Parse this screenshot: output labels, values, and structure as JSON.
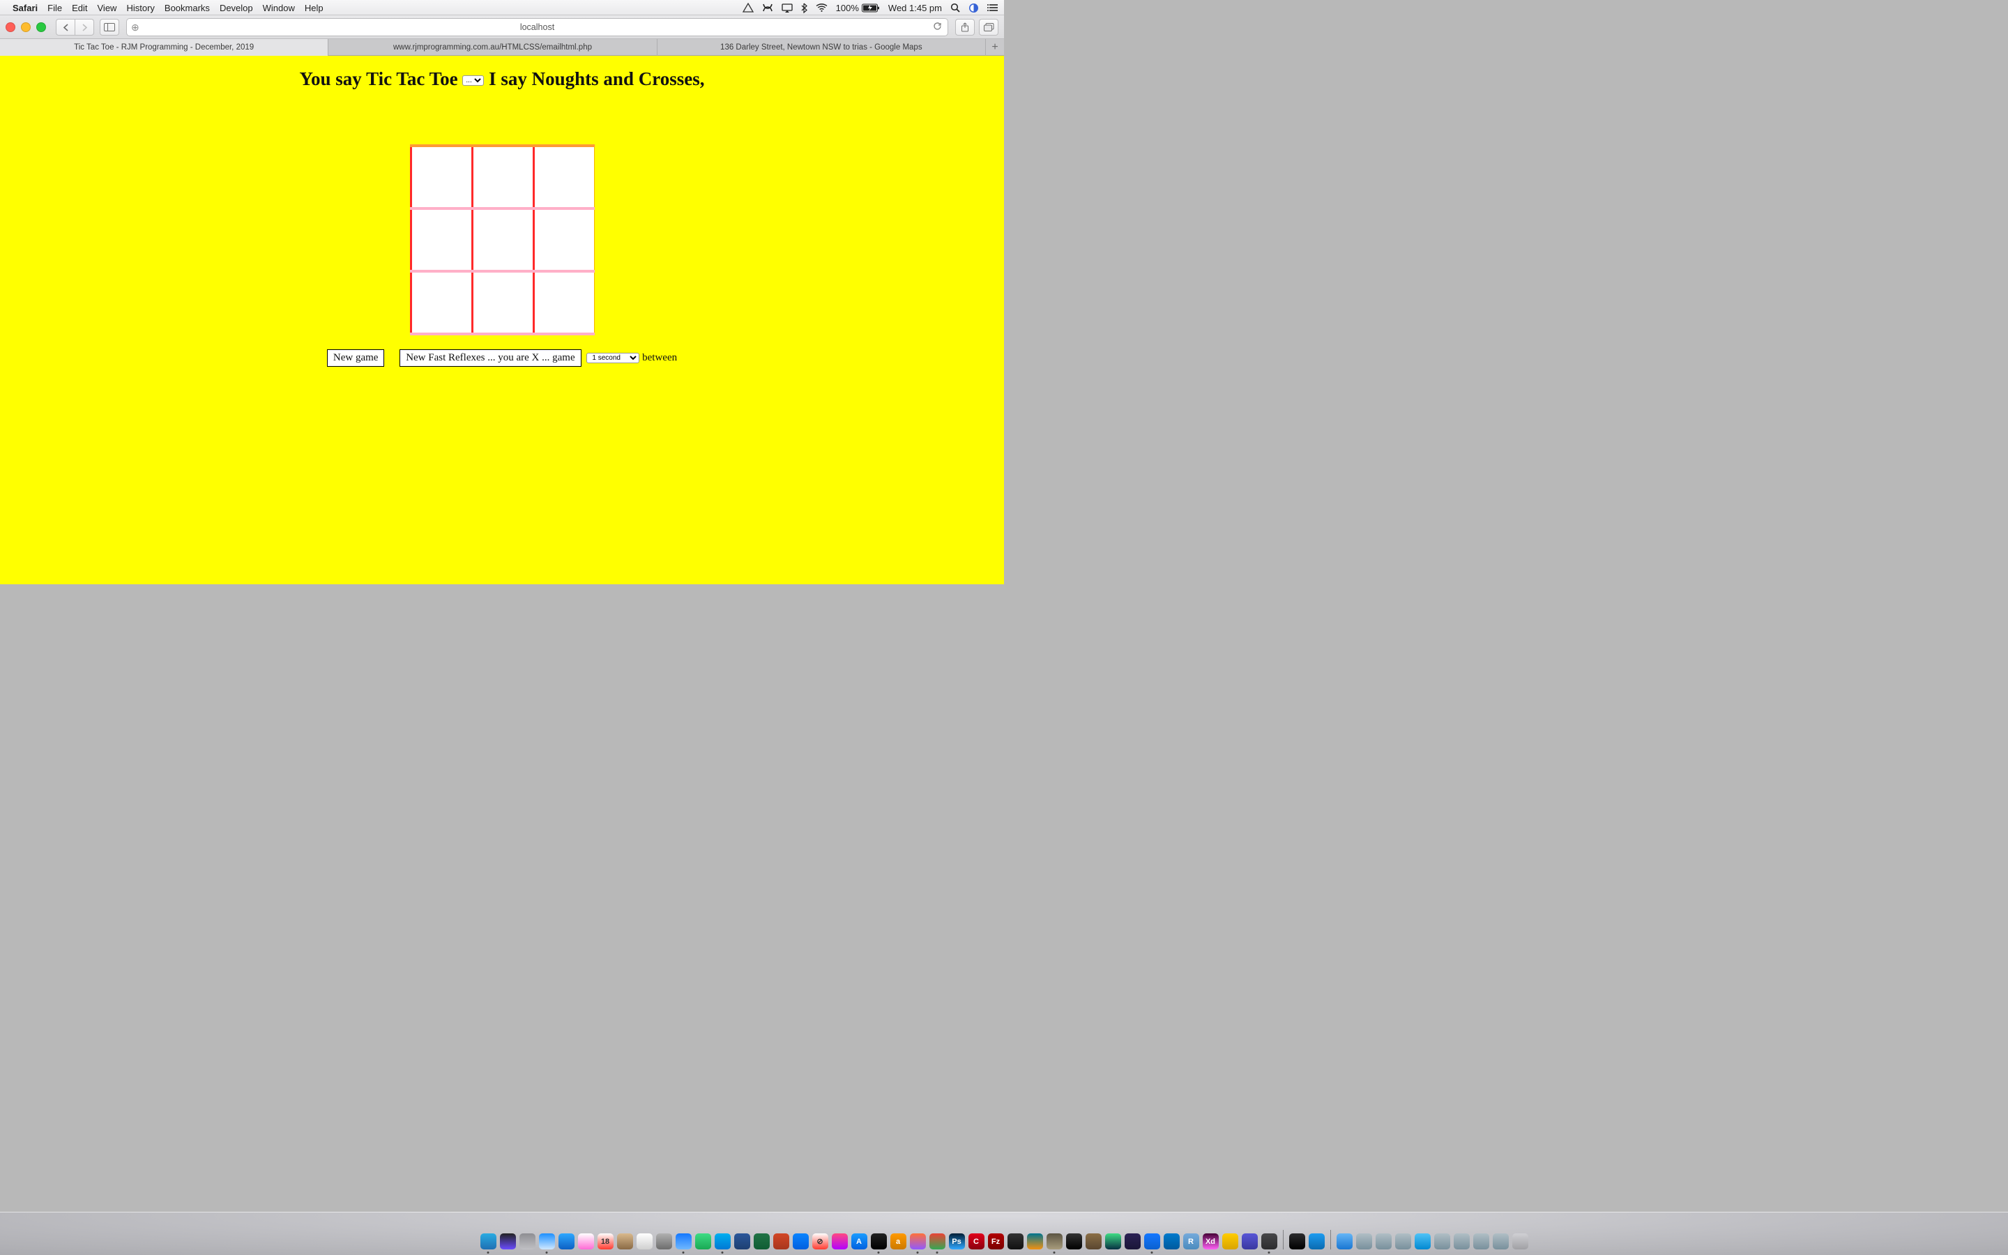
{
  "menubar": {
    "app": "Safari",
    "items": [
      "File",
      "Edit",
      "View",
      "History",
      "Bookmarks",
      "Develop",
      "Window",
      "Help"
    ],
    "battery": "100%",
    "clock": "Wed 1:45 pm"
  },
  "toolbar": {
    "url": "localhost"
  },
  "tabs": {
    "items": [
      {
        "label": "Tic Tac Toe - RJM Programming - December, 2019",
        "active": true
      },
      {
        "label": "www.rjmprogramming.com.au/HTMLCSS/emailhtml.php",
        "active": false
      },
      {
        "label": "136 Darley Street, Newtown NSW to trias - Google Maps",
        "active": false
      }
    ]
  },
  "page": {
    "heading_left": "You say Tic Tac Toe",
    "heading_select": "...",
    "heading_right": "I say Noughts and Crosses,",
    "board": [
      [
        "",
        "",
        ""
      ],
      [
        "",
        "",
        ""
      ],
      [
        "",
        "",
        ""
      ]
    ],
    "button_newgame": "New game",
    "button_fast": "New Fast Reflexes ... you are X ... game",
    "interval_select": "1 second",
    "interval_suffix": "between"
  },
  "dock": {
    "items": [
      {
        "name": "finder",
        "c1": "#29abe2",
        "c2": "#1f6fb3",
        "run": true
      },
      {
        "name": "siri",
        "c1": "#222",
        "c2": "#6a4cff"
      },
      {
        "name": "launchpad",
        "c1": "#8e8e93",
        "c2": "#c0c0c4"
      },
      {
        "name": "safari",
        "c1": "#1e90ff",
        "c2": "#cfe8ff",
        "run": true
      },
      {
        "name": "mail",
        "c1": "#2da7ff",
        "c2": "#0d60c3"
      },
      {
        "name": "photos",
        "c1": "#ffffff",
        "c2": "#ff6ad5"
      },
      {
        "name": "calendar",
        "c1": "#ffffff",
        "c2": "#ff3b30",
        "txt": "18"
      },
      {
        "name": "contacts",
        "c1": "#d9b98c",
        "c2": "#8a6a45"
      },
      {
        "name": "reminders",
        "c1": "#ffffff",
        "c2": "#d0d0d0"
      },
      {
        "name": "automator",
        "c1": "#b0b0b0",
        "c2": "#6d6d6d"
      },
      {
        "name": "preview",
        "c1": "#1478ff",
        "c2": "#70b8ff",
        "run": true
      },
      {
        "name": "messages",
        "c1": "#3ddc84",
        "c2": "#1aa954"
      },
      {
        "name": "skype",
        "c1": "#00aff0",
        "c2": "#0078d4",
        "run": true
      },
      {
        "name": "word",
        "c1": "#2b579a",
        "c2": "#1e3f72"
      },
      {
        "name": "excel",
        "c1": "#217346",
        "c2": "#0f5d34"
      },
      {
        "name": "powerpoint",
        "c1": "#d24726",
        "c2": "#a8361d"
      },
      {
        "name": "keynote",
        "c1": "#0a84ff",
        "c2": "#0060df"
      },
      {
        "name": "prohibit",
        "c1": "#ffffff",
        "c2": "#ff3b30",
        "txt": "⊘"
      },
      {
        "name": "itunes",
        "c1": "#ff4981",
        "c2": "#b200ff"
      },
      {
        "name": "appstore",
        "c1": "#1b9cff",
        "c2": "#0060df",
        "txt": "A"
      },
      {
        "name": "terminal",
        "c1": "#222",
        "c2": "#000",
        "run": true
      },
      {
        "name": "amazon",
        "c1": "#ff9900",
        "c2": "#cc7a00",
        "txt": "a"
      },
      {
        "name": "firefox",
        "c1": "#ff7139",
        "c2": "#9059ff",
        "run": true
      },
      {
        "name": "chrome",
        "c1": "#ea4335",
        "c2": "#34a853",
        "run": true
      },
      {
        "name": "photoshop",
        "c1": "#001e36",
        "c2": "#31a8ff",
        "txt": "Ps"
      },
      {
        "name": "ccleaner",
        "c1": "#e2001a",
        "c2": "#8a0010",
        "txt": "C"
      },
      {
        "name": "filezilla",
        "c1": "#b10000",
        "c2": "#7a0000",
        "txt": "Fz"
      },
      {
        "name": "mamp",
        "c1": "#333",
        "c2": "#111"
      },
      {
        "name": "mysql",
        "c1": "#00758f",
        "c2": "#f29111"
      },
      {
        "name": "gimp",
        "c1": "#5c5543",
        "c2": "#a89c7c",
        "run": true
      },
      {
        "name": "inkscape",
        "c1": "#333",
        "c2": "#000"
      },
      {
        "name": "app1",
        "c1": "#8b6f47",
        "c2": "#5a4630"
      },
      {
        "name": "android",
        "c1": "#3ddc84",
        "c2": "#073042"
      },
      {
        "name": "eclipse",
        "c1": "#2c2255",
        "c2": "#1a1538"
      },
      {
        "name": "xcode",
        "c1": "#1478ff",
        "c2": "#0a60d0",
        "run": true
      },
      {
        "name": "vscode",
        "c1": "#007acc",
        "c2": "#005a9e"
      },
      {
        "name": "rstudio",
        "c1": "#75aadb",
        "c2": "#4b8bbe",
        "txt": "R"
      },
      {
        "name": "xd",
        "c1": "#470137",
        "c2": "#ff61f6",
        "txt": "Xd"
      },
      {
        "name": "app2",
        "c1": "#ffcc00",
        "c2": "#d9a400"
      },
      {
        "name": "app3",
        "c1": "#5856d6",
        "c2": "#3a38a0"
      },
      {
        "name": "app4",
        "c1": "#48484a",
        "c2": "#2c2c2e",
        "run": true
      },
      {
        "name": "__sep__"
      },
      {
        "name": "folder1",
        "c1": "#2c2c2e",
        "c2": "#000"
      },
      {
        "name": "quicklook",
        "c1": "#1d9bf0",
        "c2": "#0a6bb0"
      },
      {
        "name": "__sep__"
      },
      {
        "name": "desk1",
        "c1": "#64b5f6",
        "c2": "#1976d2"
      },
      {
        "name": "desk2",
        "c1": "#b0bec5",
        "c2": "#78909c"
      },
      {
        "name": "desk3",
        "c1": "#b0bec5",
        "c2": "#78909c"
      },
      {
        "name": "desk4",
        "c1": "#b0bec5",
        "c2": "#78909c"
      },
      {
        "name": "desk5",
        "c1": "#4fc3f7",
        "c2": "#0288d1"
      },
      {
        "name": "desk6",
        "c1": "#b0bec5",
        "c2": "#78909c"
      },
      {
        "name": "desk7",
        "c1": "#b0bec5",
        "c2": "#78909c"
      },
      {
        "name": "desk8",
        "c1": "#b0bec5",
        "c2": "#78909c"
      },
      {
        "name": "desk9",
        "c1": "#b0bec5",
        "c2": "#78909c"
      },
      {
        "name": "trash",
        "c1": "#d0d0d4",
        "c2": "#a0a0a4"
      }
    ]
  }
}
